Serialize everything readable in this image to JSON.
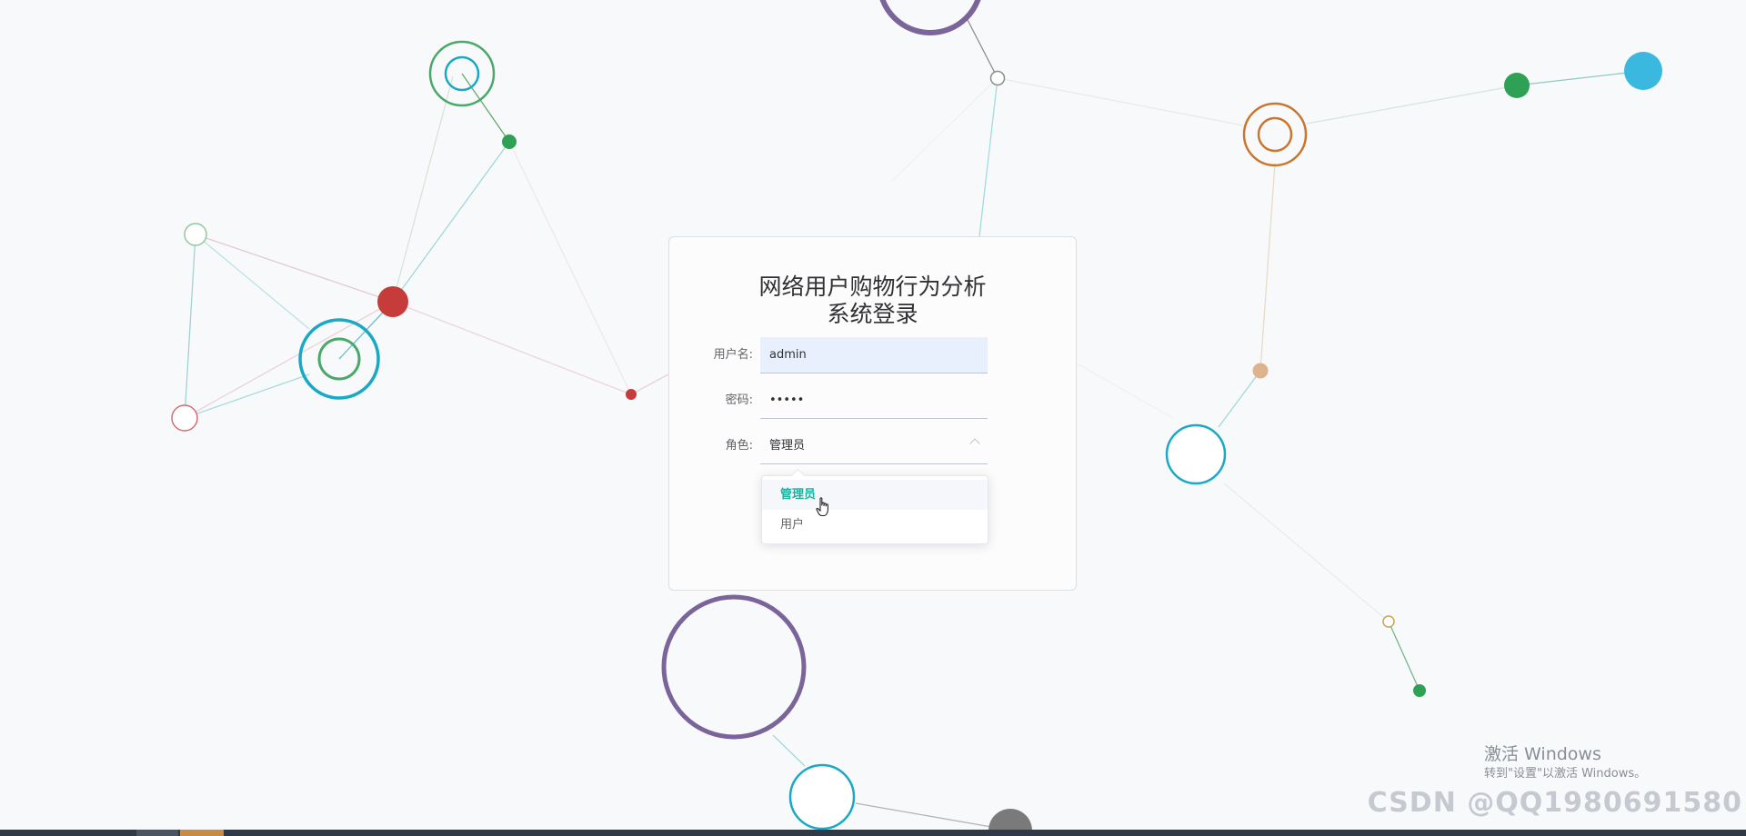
{
  "login": {
    "title_line1": "网络用户购物行为分析",
    "title_line2": "系统登录",
    "username_label": "用户名:",
    "username_value": "admin",
    "password_label": "密码:",
    "password_value": "•••••",
    "role_label": "角色:",
    "role_selected": "管理员"
  },
  "role_dropdown": {
    "options": [
      "管理员",
      "用户"
    ],
    "selected_index": 0
  },
  "watermark": {
    "windows_title": "激活 Windows",
    "windows_sub": "转到\"设置\"以激活 Windows。",
    "csdn": "CSDN @QQ1980691580"
  },
  "icons": {
    "select_arrow": "chevron-up-icon",
    "cursor": "hand-pointer-icon"
  },
  "colors": {
    "accent": "#1fb19e",
    "autofill_bg": "#e8f0fe"
  }
}
